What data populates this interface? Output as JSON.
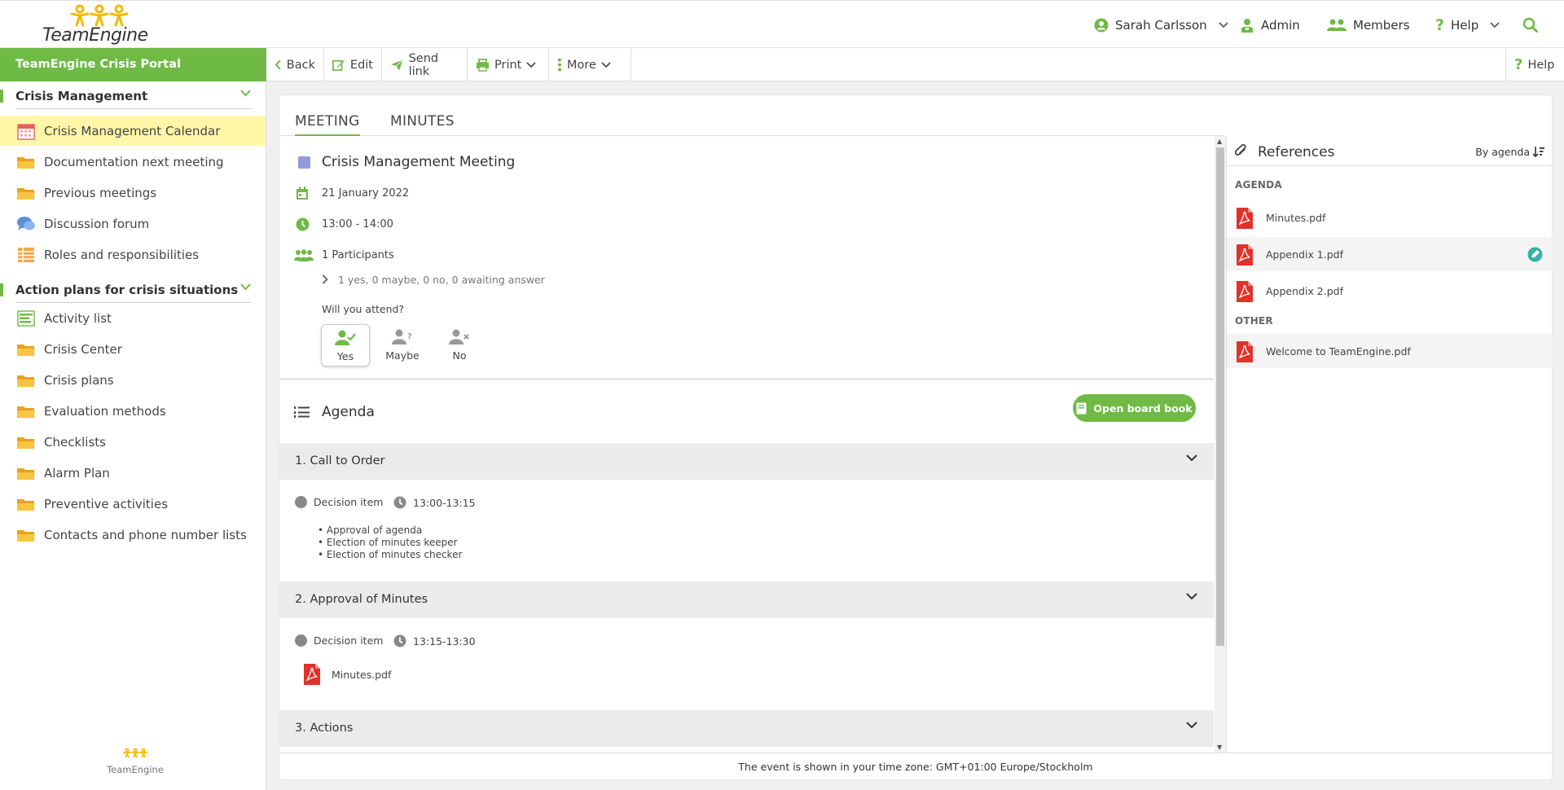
{
  "header": {
    "logo_text": "TeamEngine",
    "user_name": "Sarah Carlsson",
    "admin_label": "Admin",
    "members_label": "Members",
    "help_label": "Help"
  },
  "sidebar": {
    "portal_title": "TeamEngine Crisis Portal",
    "sections": [
      {
        "label": "Crisis Management",
        "items": [
          {
            "label": "Crisis Management Calendar",
            "icon": "calendar-icon"
          },
          {
            "label": "Documentation next meeting",
            "icon": "folder-icon"
          },
          {
            "label": "Previous meetings",
            "icon": "folder-icon"
          },
          {
            "label": "Discussion forum",
            "icon": "chat-icon"
          },
          {
            "label": "Roles and responsibilities",
            "icon": "table-icon"
          }
        ]
      },
      {
        "label": "Action plans for crisis situations",
        "items": [
          {
            "label": "Activity list",
            "icon": "list-icon"
          },
          {
            "label": "Crisis Center",
            "icon": "folder-icon"
          },
          {
            "label": "Crisis plans",
            "icon": "folder-icon"
          },
          {
            "label": "Evaluation methods",
            "icon": "folder-icon"
          },
          {
            "label": "Checklists",
            "icon": "folder-icon"
          },
          {
            "label": "Alarm Plan",
            "icon": "folder-icon"
          },
          {
            "label": "Preventive activities",
            "icon": "folder-icon"
          },
          {
            "label": "Contacts and phone number lists",
            "icon": "folder-icon"
          }
        ]
      }
    ],
    "footer_logo_text": "TeamEngine"
  },
  "toolbar": {
    "back": "Back",
    "edit": "Edit",
    "send_link": "Send link",
    "print": "Print",
    "more": "More",
    "help": "Help"
  },
  "tabs": [
    "MEETING",
    "MINUTES"
  ],
  "meeting": {
    "title": "Crisis Management Meeting",
    "date": "21 January 2022",
    "time": "13:00 - 14:00",
    "participants": "1 Participants",
    "responses": "1 yes,  0 maybe,  0 no,  0 awaiting answer",
    "attend_question": "Will you attend?",
    "attend_options": [
      "Yes",
      "Maybe",
      "No"
    ]
  },
  "agenda": {
    "title": "Agenda",
    "open_board_book": "Open board book",
    "items": [
      {
        "title": "1. Call to Order",
        "type": "Decision item",
        "time": "13:00-13:15",
        "bullets": [
          "• Approval of agenda",
          "• Election of minutes keeper",
          "• Election of minutes checker"
        ]
      },
      {
        "title": "2. Approval of Minutes",
        "type": "Decision item",
        "time": "13:15-13:30",
        "attachment": "Minutes.pdf"
      },
      {
        "title": "3. Actions"
      }
    ]
  },
  "references": {
    "title": "References",
    "sort_label": "By agenda",
    "groups": [
      {
        "label": "AGENDA",
        "files": [
          "Minutes.pdf",
          "Appendix 1.pdf",
          "Appendix 2.pdf"
        ]
      },
      {
        "label": "OTHER",
        "files": [
          "Welcome to TeamEngine.pdf"
        ]
      }
    ]
  },
  "footer": {
    "timezone_note": "The event is shown in your time zone: GMT+01:00 Europe/Stockholm"
  },
  "colors": {
    "accent": "#6fba45",
    "active_item": "#fff6a8",
    "pdf_red": "#e0322b",
    "folder_yellow": "#f5b82e",
    "meeting_square": "#9099d9"
  }
}
